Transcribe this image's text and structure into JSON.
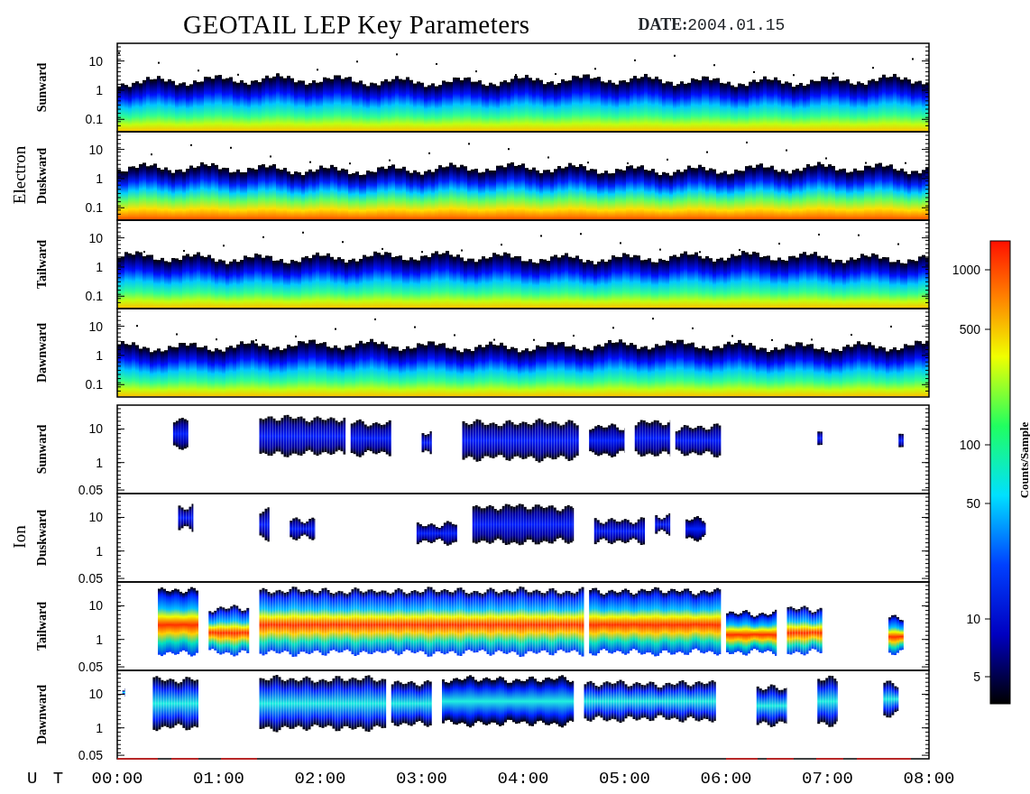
{
  "title": "GEOTAIL LEP Key Parameters",
  "date_label": "DATE:",
  "date": "2004.01.15",
  "groups": [
    {
      "label": "Electron",
      "kind": "electron",
      "panels": [
        {
          "label": "Sunward",
          "yticks": [
            "10",
            "1",
            "0.1"
          ]
        },
        {
          "label": "Duskward",
          "yticks": [
            "10",
            "1",
            "0.1"
          ]
        },
        {
          "label": "Tailward",
          "yticks": [
            "10",
            "1",
            "0.1"
          ]
        },
        {
          "label": "Dawnward",
          "yticks": [
            "10",
            "1",
            "0.1"
          ]
        }
      ]
    },
    {
      "label": "Ion",
      "kind": "ion",
      "panels": [
        {
          "label": "Sunward",
          "yticks": [
            "10",
            "1",
            "0.05"
          ]
        },
        {
          "label": "Duskward",
          "yticks": [
            "10",
            "1",
            "0.05"
          ]
        },
        {
          "label": "Tailward",
          "yticks": [
            "10",
            "1",
            "0.05"
          ]
        },
        {
          "label": "Dawnward",
          "yticks": [
            "10",
            "1",
            "0.05"
          ]
        }
      ]
    }
  ],
  "x_axis": {
    "label": "U T",
    "ticks": [
      "00:00",
      "01:00",
      "02:00",
      "03:00",
      "04:00",
      "05:00",
      "06:00",
      "07:00",
      "08:00"
    ]
  },
  "colorbar": {
    "label": "Counts/Sample",
    "ticks": [
      "1000",
      "500",
      "100",
      "50",
      "10",
      "5"
    ]
  }
}
